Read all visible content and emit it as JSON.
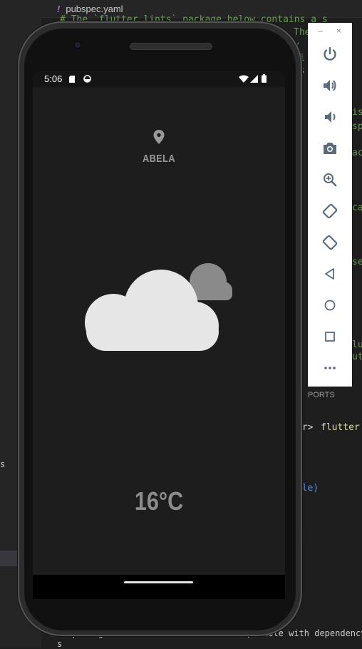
{
  "editor": {
    "tab_label": "pubspec.yaml",
    "lines": [
      {
        "text": "# The `flutter_lints` package below contains a s",
        "cls": "green"
      },
      {
        "text": "The",
        "cls": "green"
      },
      {
        "text": "y",
        "cls": "green"
      },
      {
        "text": "ti",
        "cls": "green"
      },
      {
        "text": "es",
        "cls": "green"
      },
      {
        "text": "a",
        "cls": "green"
      },
      {
        "text": "is",
        "cls": "green"
      },
      {
        "text": "sp",
        "cls": "green"
      },
      {
        "text": "ac",
        "cls": "green"
      },
      {
        "text": "ca",
        "cls": "green"
      },
      {
        "text": "se",
        "cls": "green"
      },
      {
        "text": "lu",
        "cls": "green"
      },
      {
        "text": "ut",
        "cls": "green"
      }
    ],
    "ports_label": "PORTS",
    "terminal_prompt": "er>",
    "terminal_cmd": "flutter p",
    "terminal_able": "able)",
    "terminal_paren": ")",
    "bottom_line": "11 packages have newer versions incompatible with dependency c",
    "bottom_line2": "s",
    "sidebar_letter": "s"
  },
  "phone": {
    "status_time": "5:06",
    "city": "ABELA",
    "temperature": "16°C"
  },
  "icons": {
    "location": "location-pin-icon",
    "weather": "partly-cloudy-icon"
  },
  "colors": {
    "screen_bg": "#1d1d1d",
    "cloud_front": "#e6e6e6",
    "cloud_back": "#8a8a8a",
    "text_muted": "#9a9a9a"
  },
  "emulator": {
    "minimize": "–",
    "close": "×",
    "buttons": [
      "power-icon",
      "volume-up-icon",
      "volume-down-icon",
      "camera-icon",
      "zoom-icon",
      "rotate-left-icon",
      "rotate-right-icon",
      "back-icon",
      "home-icon",
      "overview-icon",
      "more-icon"
    ]
  }
}
